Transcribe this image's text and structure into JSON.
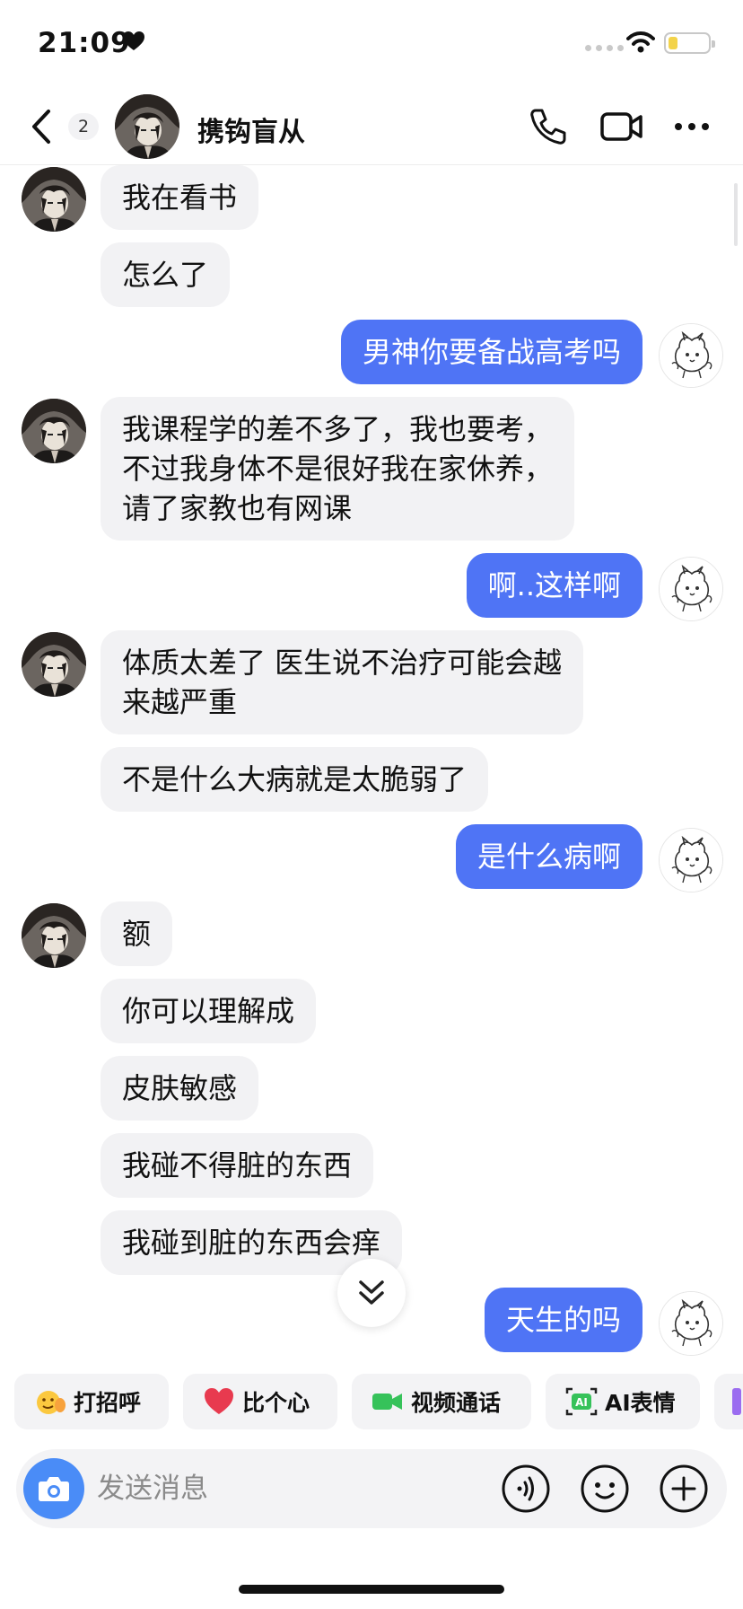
{
  "status_bar": {
    "time": "21:09",
    "battery_color": "#f3d34a"
  },
  "header": {
    "unread_count": "2",
    "contact_name": "携钩盲从"
  },
  "messages": [
    {
      "side": "in",
      "text": "我在看书"
    },
    {
      "side": "in",
      "text": "怎么了"
    },
    {
      "side": "out",
      "text": "男神你要备战高考吗"
    },
    {
      "side": "in",
      "text": "我课程学的差不多了，我也要考，\n不过我身体不是很好我在家休养，\n请了家教也有网课"
    },
    {
      "side": "out",
      "text": "啊..这样啊"
    },
    {
      "side": "in",
      "text": "体质太差了 医生说不治疗可能会越\n来越严重"
    },
    {
      "side": "in",
      "text": "不是什么大病就是太脆弱了"
    },
    {
      "side": "out",
      "text": "是什么病啊"
    },
    {
      "side": "in",
      "text": "额"
    },
    {
      "side": "in",
      "text": "你可以理解成"
    },
    {
      "side": "in",
      "text": "皮肤敏感"
    },
    {
      "side": "in",
      "text": "我碰不得脏的东西"
    },
    {
      "side": "in",
      "text": "我碰到脏的东西会痒"
    },
    {
      "side": "out",
      "text": "天生的吗"
    }
  ],
  "quick_actions": [
    {
      "label": "打招呼",
      "icon": "wave-emoji-icon"
    },
    {
      "label": "比个心",
      "icon": "heart-icon"
    },
    {
      "label": "视频通话",
      "icon": "video-call-icon"
    },
    {
      "label": "AI表情",
      "icon": "ai-sticker-icon"
    }
  ],
  "input": {
    "placeholder": "发送消息"
  },
  "colors": {
    "outgoing_bubble": "#4f74f5",
    "incoming_bubble": "#f2f2f4",
    "camera_button": "#4a8cf7"
  }
}
